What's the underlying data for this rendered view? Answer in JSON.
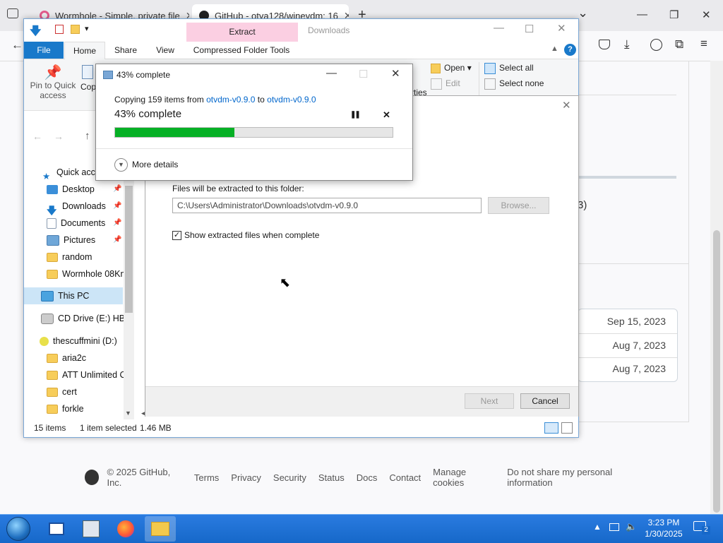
{
  "browser": {
    "tabs": [
      {
        "title": "Wormhole - Simple, private file",
        "close": "✕"
      },
      {
        "title": "GitHub - otya128/winevdm: 16",
        "close": "✕"
      }
    ],
    "new_tab": "+",
    "list_tabs": "⌄",
    "win_min": "—",
    "win_max": "❐",
    "win_close": "✕"
  },
  "github": {
    "partial_text": "3)",
    "dates": [
      "Sep 15, 2023",
      "Aug 7, 2023",
      "Aug 7, 2023"
    ],
    "footer": {
      "copyright": "© 2025 GitHub, Inc.",
      "links": [
        "Terms",
        "Privacy",
        "Security",
        "Status",
        "Docs",
        "Contact",
        "Manage cookies",
        "Do not share my personal information"
      ]
    }
  },
  "explorer": {
    "contextual_group": "Extract",
    "title": "Downloads",
    "ribbon_tabs": [
      "File",
      "Home",
      "Share",
      "View",
      "Compressed Folder Tools"
    ],
    "ribbon": {
      "pin_label_1": "Pin to Quick",
      "pin_label_2": "access",
      "copy_label": "Cop",
      "properties_label": "rties",
      "open_label": "Open",
      "open_arrow": "▾",
      "edit_label": "Edit",
      "select_all": "Select all",
      "select_none": "Select none"
    },
    "nav_pane": {
      "quick_access": "Quick acce",
      "items": [
        {
          "label": "Desktop",
          "pinned": true
        },
        {
          "label": "Downloads",
          "pinned": true
        },
        {
          "label": "Documents",
          "pinned": true
        },
        {
          "label": "Pictures",
          "pinned": true
        },
        {
          "label": "random",
          "pinned": false
        },
        {
          "label": "Wormhole 08Kn",
          "pinned": false
        }
      ],
      "this_pc": "This PC",
      "cd_drive": "CD Drive (E:) HBC",
      "drive_d": "thescuffmini (D:)",
      "d_items": [
        "aria2c",
        "ATT Unlimited C",
        "cert",
        "forkle"
      ]
    },
    "status": {
      "items": "15 items",
      "selected": "1 item selected",
      "size": "1.46 MB"
    }
  },
  "wizard": {
    "dest_label": "Files will be extracted to this folder:",
    "dest_path": "C:\\Users\\Administrator\\Downloads\\otvdm-v0.9.0",
    "browse": "Browse...",
    "show_files_label": "Show extracted files when complete",
    "show_files_checked": true,
    "next": "Next",
    "cancel": "Cancel",
    "close": "✕"
  },
  "copy_dialog": {
    "title": "43% complete",
    "copying_prefix": "Copying 159 items from",
    "source": "otvdm-v0.9.0",
    "to": "to",
    "dest": "otvdm-v0.9.0",
    "percent_text": "43% complete",
    "progress": 0.43,
    "more_details": "More details",
    "pause": "❚❚",
    "stop": "✕"
  },
  "taskbar": {
    "time": "3:23 PM",
    "date": "1/30/2025",
    "notifications": "2"
  }
}
